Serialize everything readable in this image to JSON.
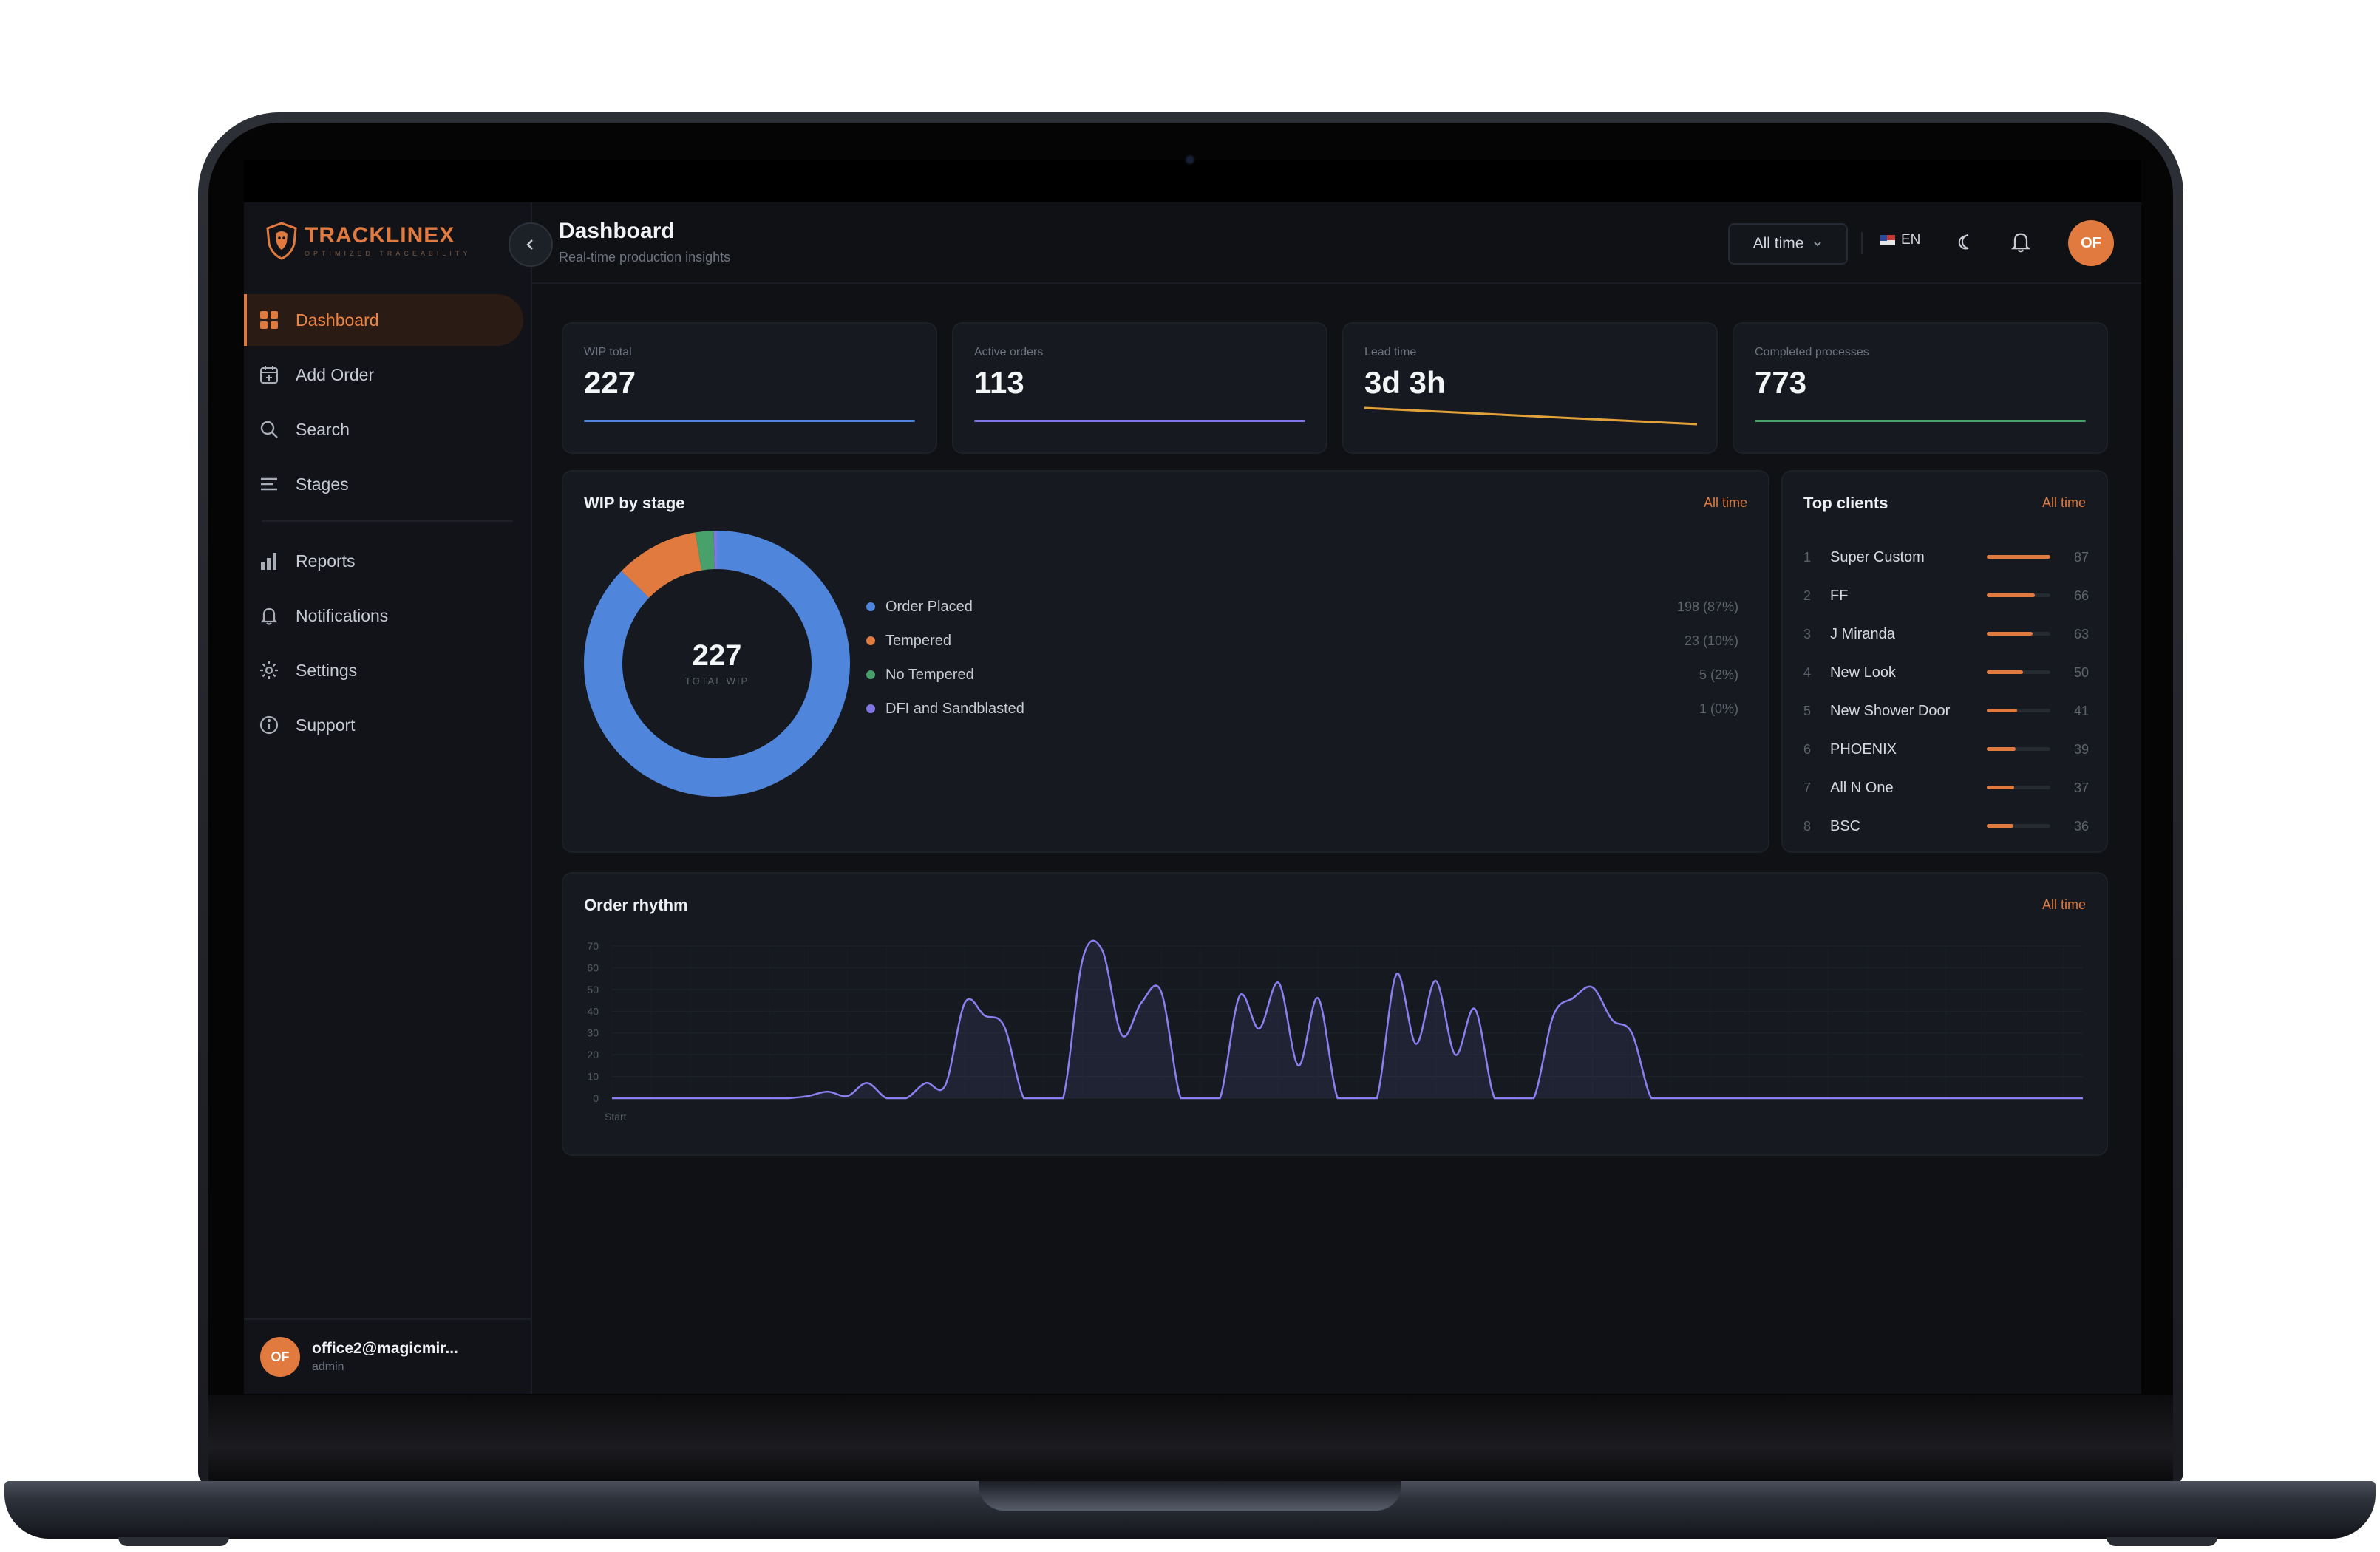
{
  "brand": {
    "name": "TRACKLINEX",
    "tagline": "OPTIMIZED TRACEABILITY"
  },
  "colors": {
    "accent": "#e07a3e",
    "blue": "#4f86db",
    "purple": "#7f76e3",
    "green": "#48a06a",
    "amber": "#e3a13a"
  },
  "sidebar": {
    "items": [
      {
        "label": "Dashboard",
        "icon": "grid-icon",
        "active": true
      },
      {
        "label": "Add Order",
        "icon": "calendar-plus-icon"
      },
      {
        "label": "Search",
        "icon": "search-icon"
      },
      {
        "label": "Stages",
        "icon": "list-icon"
      },
      {
        "label": "Reports",
        "icon": "bar-chart-icon"
      },
      {
        "label": "Notifications",
        "icon": "bell-icon"
      },
      {
        "label": "Settings",
        "icon": "gear-icon"
      },
      {
        "label": "Support",
        "icon": "info-icon"
      }
    ],
    "user": {
      "initials": "OF",
      "email": "office2@magicmir...",
      "role": "admin"
    }
  },
  "header": {
    "title": "Dashboard",
    "subtitle": "Real-time production insights",
    "range": "All time",
    "language": "EN",
    "avatar_initials": "OF"
  },
  "stats": [
    {
      "label": "WIP total",
      "value": "227"
    },
    {
      "label": "Active orders",
      "value": "113"
    },
    {
      "label": "Lead time",
      "value": "3d 3h"
    },
    {
      "label": "Completed processes",
      "value": "773"
    }
  ],
  "wip_by_stage": {
    "title": "WIP by stage",
    "link": "All time",
    "center_value": "227",
    "center_label": "TOTAL WIP",
    "items": [
      {
        "name": "Order Placed",
        "value_text": "198 (87%)",
        "color": "#4f86db"
      },
      {
        "name": "Tempered",
        "value_text": "23 (10%)",
        "color": "#e07a3e"
      },
      {
        "name": "No Tempered",
        "value_text": "5 (2%)",
        "color": "#48a06a"
      },
      {
        "name": "DFI and Sandblasted",
        "value_text": "1 (0%)",
        "color": "#7f76e3"
      }
    ]
  },
  "top_clients": {
    "title": "Top clients",
    "link": "All time",
    "items": [
      {
        "rank": "1",
        "name": "Super Custom",
        "value": "87"
      },
      {
        "rank": "2",
        "name": "FF",
        "value": "66"
      },
      {
        "rank": "3",
        "name": "J Miranda",
        "value": "63"
      },
      {
        "rank": "4",
        "name": "New Look",
        "value": "50"
      },
      {
        "rank": "5",
        "name": "New Shower Door",
        "value": "41"
      },
      {
        "rank": "6",
        "name": "PHOENIX",
        "value": "39"
      },
      {
        "rank": "7",
        "name": "All N One",
        "value": "37"
      },
      {
        "rank": "8",
        "name": "BSC",
        "value": "36"
      }
    ]
  },
  "order_rhythm": {
    "title": "Order rhythm",
    "link": "All time",
    "x_start_label": "Start"
  },
  "chart_data": {
    "type": "area",
    "title": "Order rhythm",
    "ylim": [
      0,
      70
    ],
    "yticks": [
      "0",
      "10",
      "20",
      "30",
      "40",
      "50",
      "60",
      "70"
    ],
    "x_label_first": "Start",
    "values": [
      0,
      0,
      0,
      0,
      0,
      0,
      0,
      0,
      0,
      0,
      1,
      3,
      1,
      7,
      0,
      0,
      7,
      6,
      44,
      38,
      33,
      0,
      0,
      0,
      64,
      68,
      29,
      44,
      49,
      0,
      0,
      0,
      47,
      32,
      53,
      15,
      46,
      0,
      0,
      0,
      57,
      25,
      54,
      20,
      41,
      0,
      0,
      0,
      38,
      46,
      51,
      36,
      30,
      0,
      0,
      0,
      0,
      0,
      0,
      0,
      0,
      0,
      0,
      0,
      0,
      0,
      0,
      0,
      0,
      0,
      0,
      0,
      0,
      0,
      0,
      0
    ]
  }
}
